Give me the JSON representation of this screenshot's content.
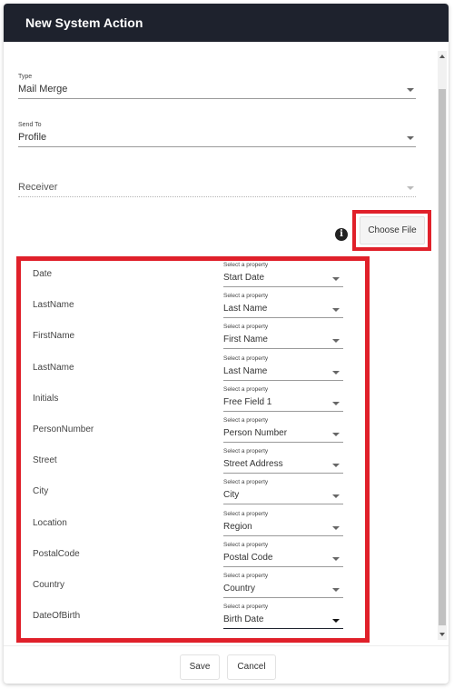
{
  "dialog": {
    "title": "New System Action"
  },
  "form": {
    "type": {
      "label": "Type",
      "value": "Mail Merge"
    },
    "send_to": {
      "label": "Send To",
      "value": "Profile"
    },
    "receiver": {
      "value": "Receiver"
    }
  },
  "file": {
    "info_glyph": "i",
    "choose_file_label": "Choose File"
  },
  "mapping": {
    "hint": "Select a property",
    "rows": [
      {
        "field": "Date",
        "property": "Start Date"
      },
      {
        "field": "LastName",
        "property": "Last Name"
      },
      {
        "field": "FirstName",
        "property": "First Name"
      },
      {
        "field": "LastName",
        "property": "Last Name"
      },
      {
        "field": "Initials",
        "property": "Free Field 1"
      },
      {
        "field": "PersonNumber",
        "property": "Person Number"
      },
      {
        "field": "Street",
        "property": "Street Address"
      },
      {
        "field": "City",
        "property": "City"
      },
      {
        "field": "Location",
        "property": "Region"
      },
      {
        "field": "PostalCode",
        "property": "Postal Code"
      },
      {
        "field": "Country",
        "property": "Country"
      },
      {
        "field": "DateOfBirth",
        "property": "Birth Date"
      }
    ]
  },
  "footer": {
    "save_label": "Save",
    "cancel_label": "Cancel"
  },
  "colors": {
    "header_bg": "#1e222d",
    "highlight": "#e0202a"
  }
}
